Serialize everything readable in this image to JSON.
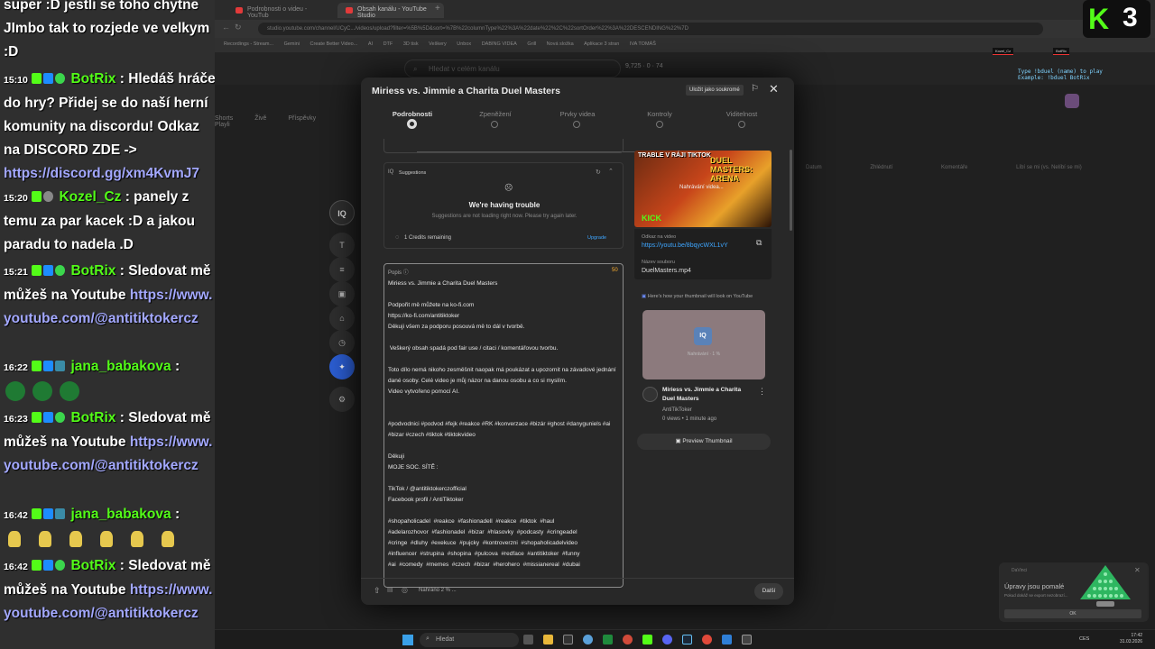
{
  "browser": {
    "tabs": [
      {
        "label": "Podrobnosti o videu - YouTub"
      },
      {
        "label": "Obsah kanálu - YouTube Studio"
      }
    ],
    "address": "studio.youtube.com/channel/UCyC.../videos/upload?filter=%5B%5D&sort=%7B%22columnType%22%3A%22date%22%2C%22sortOrder%22%3A%22DESCENDING%22%7D",
    "bookmarks": [
      "Recordings - Stream...",
      "Gemini",
      "Create Better Video...",
      "AI",
      "DTF",
      "3D tisk",
      "Veškery",
      "Unbox",
      "DABING VIDEA",
      "Grill",
      "Nová složka",
      "Aplikace 3 stran",
      "IVA TOMÁŠ"
    ],
    "studio_search_placeholder": "Hledat v celém kanálu",
    "studio_stats": "9,725 · 0 · 74",
    "bg_tabs": [
      "Shorts",
      "Živě",
      "Příspěvky",
      "Playli"
    ],
    "bg_columns": [
      "Datum",
      "Zhlédnutí",
      "Komentáře",
      "Líbí se mi (vs. Nelíbí se mi)"
    ]
  },
  "chat": {
    "messages": [
      {
        "time": "",
        "user": "",
        "text": "super :D jestli se toho chytne JImbo tak to rozjede ve velkym :D",
        "link": ""
      },
      {
        "time": "15:10",
        "user": "BotRix",
        "text": ": Hledáš hráče do hry? Přidej se do naší herní komunity na discordu! Odkaz na DISCORD ZDE ->",
        "link": "https://discord.gg/xm4KvmJ7"
      },
      {
        "time": "15:20",
        "user": "Kozel_Cz",
        "text": ": panely z temu za par kacek :D a jakou paradu to nadela .D",
        "link": ""
      },
      {
        "time": "15:21",
        "user": "BotRix",
        "text": ": Sledovat mě můžeš na Youtube",
        "link": "https://www.youtube.com/@antitiktokercz"
      },
      {
        "time": "16:22",
        "user": "jana_babakova",
        "text": ":",
        "link": ""
      },
      {
        "time": "16:23",
        "user": "BotRix",
        "text": ": Sledovat mě můžeš na Youtube",
        "link": "https://www.youtube.com/@antitiktokercz"
      },
      {
        "time": "16:42",
        "user": "jana_babakova",
        "text": ":",
        "link": ""
      },
      {
        "time": "16:42",
        "user": "BotRix",
        "text": ": Sledovat mě můžeš na Youtube",
        "link": "https://www.youtube.com/@antitiktokercz"
      }
    ]
  },
  "modal": {
    "title": "Miriess vs. Jimmie a Charita Duel Masters",
    "save_private": "Uložit jako soukromé",
    "steps": [
      "Podrobnosti",
      "Zpeněžení",
      "Prvky videa",
      "Kontroly",
      "Viditelnost"
    ],
    "suggestions": {
      "title": "Suggestions",
      "trouble": "We're having trouble",
      "sub": "Suggestions are not loading right now. Please try again later.",
      "credits": "1 Credits remaining",
      "upgrade": "Upgrade"
    },
    "description": {
      "label": "Popis",
      "count": "50",
      "text": "Miriess vs. Jimmie a Charita Duel Masters\n\nPodpořit mě můžete na ko-fi.com\nhttps://ko-fi.com/antitiktoker\nDěkuji všem za podporu posouvá mě to dál v tvorbě.\n\n Veškerý obsah spadá pod fair use / citaci / komentářovou tvorbu.\n\nToto dílo nemá nikoho zesměšnit naopak má poukázat a upozornit na závadové jednání dané osoby. Celé video je můj názor na danou osobu a co si myslím.\nVideo vytvořeno pomocí AI.\n\n\n#podvodnici #podvod #fejk #reakce #RK #konverzace #bizár #ghost #danyguniels #ai #bizar #czech #tiktok #tiktokvideo\n\nDěkuji\nMOJE SOC. SÍTĚ :\n\nTikTok / @antitiktokerczofficial\nFacebook profil / AntiTiktoker\n\n#shopaholicadel  #reakce  #fashionadell  #reakce  #tiktok  #haul\n#adelarozhovor  #fashionadel  #bizar  #hlasovky  #podcasty  #cringeadel\n#cringe  #dluhy  #exekuce  #pujcky  #kontroverzni  #shopaholicadelvideo\n#influencer  #strupina  #shopina  #pulcova  #redface  #antitiktoker  #funny\n#ai  #comedy  #memes  #czech  #bizar  #herohero  #missianereal  #dubai"
    },
    "thumbnail": {
      "top_text": "TRABLE V RÁJI TIKTOK",
      "arena": "DUEL MASTERS: ARENA",
      "uploading": "Nahrávání videa...",
      "kick": "KICK"
    },
    "video_link_label": "Odkaz na video",
    "video_link": "https://youtu.be/8bqycWXL1vY",
    "file_name_label": "Název souboru",
    "file_name": "DuelMasters.mp4",
    "preview": {
      "note": "Here's how your thumbnail will look on YouTube",
      "logo": "IQ",
      "sub": "Nahrávání · 1 %",
      "title": "Miriess vs. Jimmie a Charita Duel Masters",
      "channel": "AntiTikToker",
      "meta": "0 views • 1 minute ago",
      "button": "Preview Thumbnail"
    },
    "footer": {
      "status": "Nahráno 2 % ...",
      "next": "Další"
    }
  },
  "overlay": {
    "k3_letter": "K",
    "k3_number": "3",
    "duel_hint_1": "Type !bduel (name) to play",
    "duel_hint_2": "Example: !bduel BotRix",
    "mini_tags": [
      "Kozel_Cz",
      "BotRix"
    ]
  },
  "toast": {
    "app": "DaVinci",
    "title": "Úpravy jsou pomalé",
    "sub": "Pokud dokáž se export nezobrazí...",
    "ok": "OK"
  },
  "taskbar": {
    "search": "Hledat",
    "lang": "CES",
    "time": "17:42",
    "date": "31.03.2026"
  }
}
